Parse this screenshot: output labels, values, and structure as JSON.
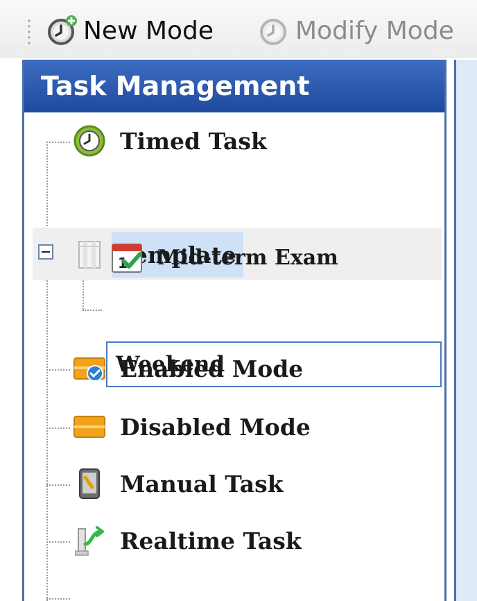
{
  "toolbar": {
    "new_mode_label": "New Mode",
    "modify_mode_label": "Modify Mode"
  },
  "panel": {
    "title": "Task Management"
  },
  "tree": {
    "timed_task": "Timed Task",
    "template": "Template",
    "mid_term_exam": "Mid-term Exam",
    "weekend": "Weekend",
    "enabled_mode": "Enabled Mode",
    "disabled_mode": "Disabled Mode",
    "manual_task": "Manual Task",
    "realtime_task": "Realtime Task"
  },
  "colors": {
    "header": "#2a56a8",
    "selection": "#cfe1f6",
    "edit_border": "#4a79c4"
  }
}
